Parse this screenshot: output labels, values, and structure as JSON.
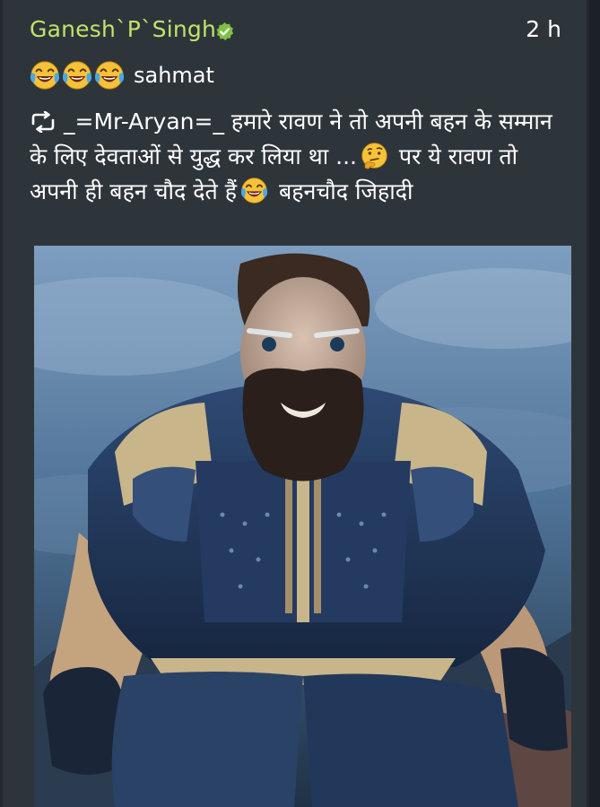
{
  "post": {
    "author": "Ganesh`P`Singh",
    "time": "2 h",
    "reaction_text": "sahmat",
    "repost_author": "_=Mr-Aryan=_",
    "line1_rest": " हमारे रावण ने तो अपनी बहन के सम्मान",
    "line2": "के लिए देवताओं से युद्ध कर लिया था ...",
    "line2_after": " पर ये रावण तो",
    "line3": "अपनी ही बहन चौद देते हैं",
    "line3_after": " बहनचौद जिहादी"
  },
  "icons": {
    "verified": "verified-badge-icon",
    "laughing": "face-with-tears-of-joy-icon",
    "thinking": "thinking-face-icon",
    "repost": "repost-icon"
  },
  "colors": {
    "background": "#2e353a",
    "author": "#bfe36a",
    "text": "#ffffff",
    "verified": "#7cc242"
  }
}
